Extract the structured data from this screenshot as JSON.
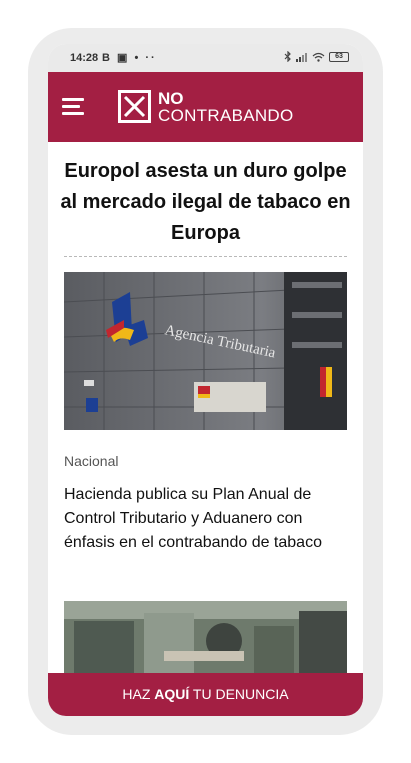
{
  "status_bar": {
    "time": "14:28",
    "left_icons": "B ▣ • ··",
    "battery": "63"
  },
  "header": {
    "logo_line1": "NO",
    "logo_line2": "CONTRABANDO"
  },
  "headline": "Europol asesta un duro golpe al mercado ilegal de tabaco en Europa",
  "article": {
    "image_sign_text": "Agencia Tributaria",
    "category": "Nacional",
    "title": "Hacienda publica su Plan Anual de Control Tributario y Aduanero con énfasis en el contrabando de tabaco"
  },
  "cta": {
    "prefix": "HAZ ",
    "emphasis": "AQUÍ",
    "suffix": " TU DENUNCIA"
  },
  "colors": {
    "brand": "#a31f43"
  }
}
